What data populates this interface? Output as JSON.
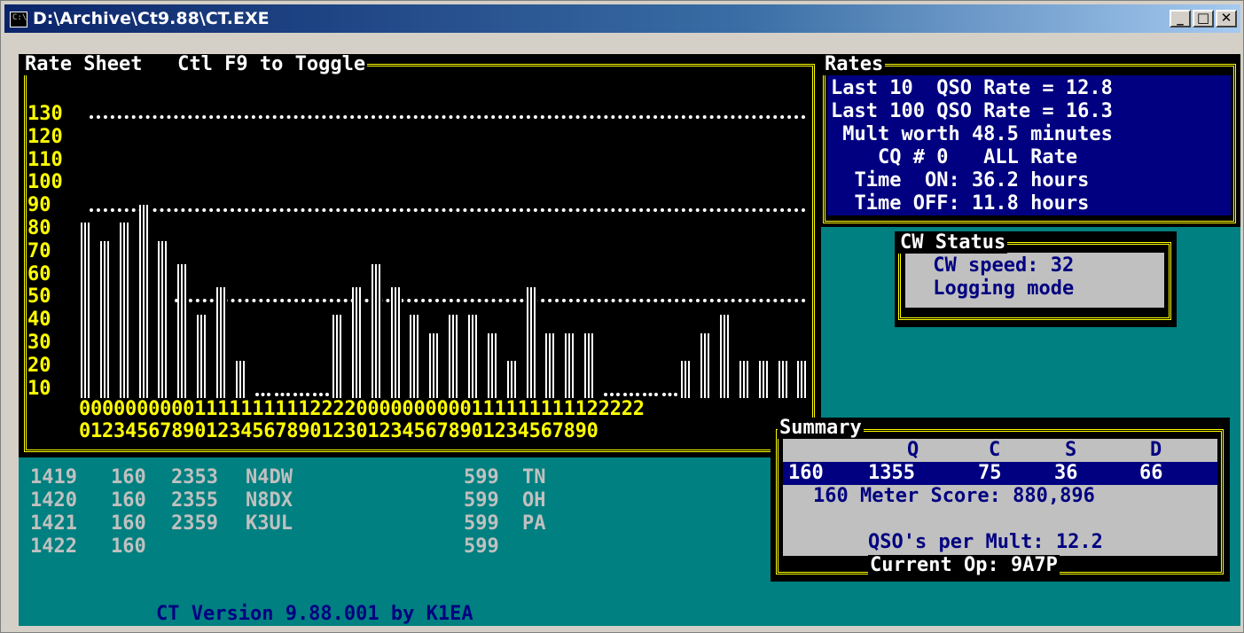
{
  "window": {
    "title": "D:\\Archive\\Ct9.88\\CT.EXE",
    "icon": "console-icon",
    "buttons": {
      "minimize": "_",
      "maximize": "□",
      "close": "✕"
    }
  },
  "rate_sheet": {
    "header": "Rate Sheet   Ctl F9 to Toggle",
    "y_labels": [
      "130",
      "120",
      "110",
      "100",
      "90",
      "80",
      "70",
      "60",
      "50",
      "40",
      "30",
      "20",
      "10"
    ],
    "x_labels_row1": "0000000000111111111122220000000000111111111122222",
    "x_labels_row2": "0123456789012345678901230123456789012345678901234567890",
    "x_labels_row2_shown": "012345678901234567890123012345678901234567890"
  },
  "chart_data": {
    "type": "bar",
    "title": "Rate Sheet",
    "ylim": [
      0,
      130
    ],
    "y_ticks": [
      10,
      20,
      30,
      40,
      50,
      60,
      70,
      80,
      90,
      100,
      110,
      120,
      130
    ],
    "reference_lines": [
      130,
      90,
      50
    ],
    "hours": [
      "00",
      "01",
      "02",
      "03",
      "04",
      "05",
      "06",
      "07",
      "08",
      "09",
      "10",
      "11",
      "12",
      "13",
      "14",
      "15",
      "16",
      "17",
      "18",
      "19",
      "20",
      "21",
      "22",
      "23",
      "00",
      "01",
      "02",
      "03",
      "04",
      "05",
      "06",
      "07",
      "08",
      "09",
      "10",
      "11",
      "12",
      "13",
      "14",
      "15",
      "16",
      "17",
      "18",
      "19",
      "20"
    ],
    "series": [
      {
        "values": [
          [
            76,
            68,
            76,
            84,
            68,
            58,
            36,
            48,
            16
          ],
          [
            0,
            0,
            0,
            0
          ],
          [
            36,
            48,
            58,
            48,
            36,
            28,
            36,
            36,
            28,
            16,
            48,
            28,
            28,
            28
          ],
          [
            0,
            0,
            0,
            0
          ],
          [
            16,
            28,
            36,
            16,
            16,
            16,
            16
          ]
        ]
      }
    ],
    "values": [
      76,
      68,
      76,
      84,
      68,
      58,
      36,
      48,
      16,
      0,
      0,
      0,
      0,
      36,
      48,
      58,
      48,
      36,
      28,
      36,
      36,
      28,
      16,
      48,
      28,
      28,
      28,
      0,
      0,
      0,
      0,
      16,
      28,
      36,
      16,
      16,
      16,
      16
    ]
  },
  "rates": {
    "header": "Rates",
    "lines": [
      "Last 10  QSO Rate = 12.8",
      "Last 100 QSO Rate = 16.3",
      " Mult worth 48.5 minutes",
      "    CQ # 0   ALL Rate",
      "  Time  ON: 36.2 hours",
      "  Time OFF: 11.8 hours"
    ]
  },
  "cw_status": {
    "header": "CW Status",
    "speed": " CW speed: 32",
    "mode": " Logging mode"
  },
  "log": {
    "rows": [
      {
        "nr": "1419",
        "band": "160",
        "time": "2353",
        "call": "N4DW",
        "rst": "599",
        "qth": "TN"
      },
      {
        "nr": "1420",
        "band": "160",
        "time": "2355",
        "call": "N8DX",
        "rst": "599",
        "qth": "OH"
      },
      {
        "nr": "1421",
        "band": "160",
        "time": "2359",
        "call": "K3UL",
        "rst": "599",
        "qth": "PA"
      },
      {
        "nr": "1422",
        "band": "160",
        "time": "",
        "call": "",
        "rst": "599",
        "qth": ""
      }
    ]
  },
  "summary": {
    "header": "Summary",
    "columns": [
      "Q",
      "C",
      "S",
      "D"
    ],
    "band": "160",
    "q": "1355",
    "c": "75",
    "s": "36",
    "d": "66",
    "score": "160 Meter Score: 880,896",
    "per_mult": "QSO's per Mult: 12.2",
    "current_op": "Current Op: 9A7P"
  },
  "footer": {
    "version": "CT Version 9.88.001 by K1EA"
  },
  "colors": {
    "console_bg": "#008080",
    "frame_yellow": "#ffff00",
    "rates_bg": "#000080",
    "cw_bg": "#c0c0c0",
    "log_text": "#c0c0c0"
  }
}
